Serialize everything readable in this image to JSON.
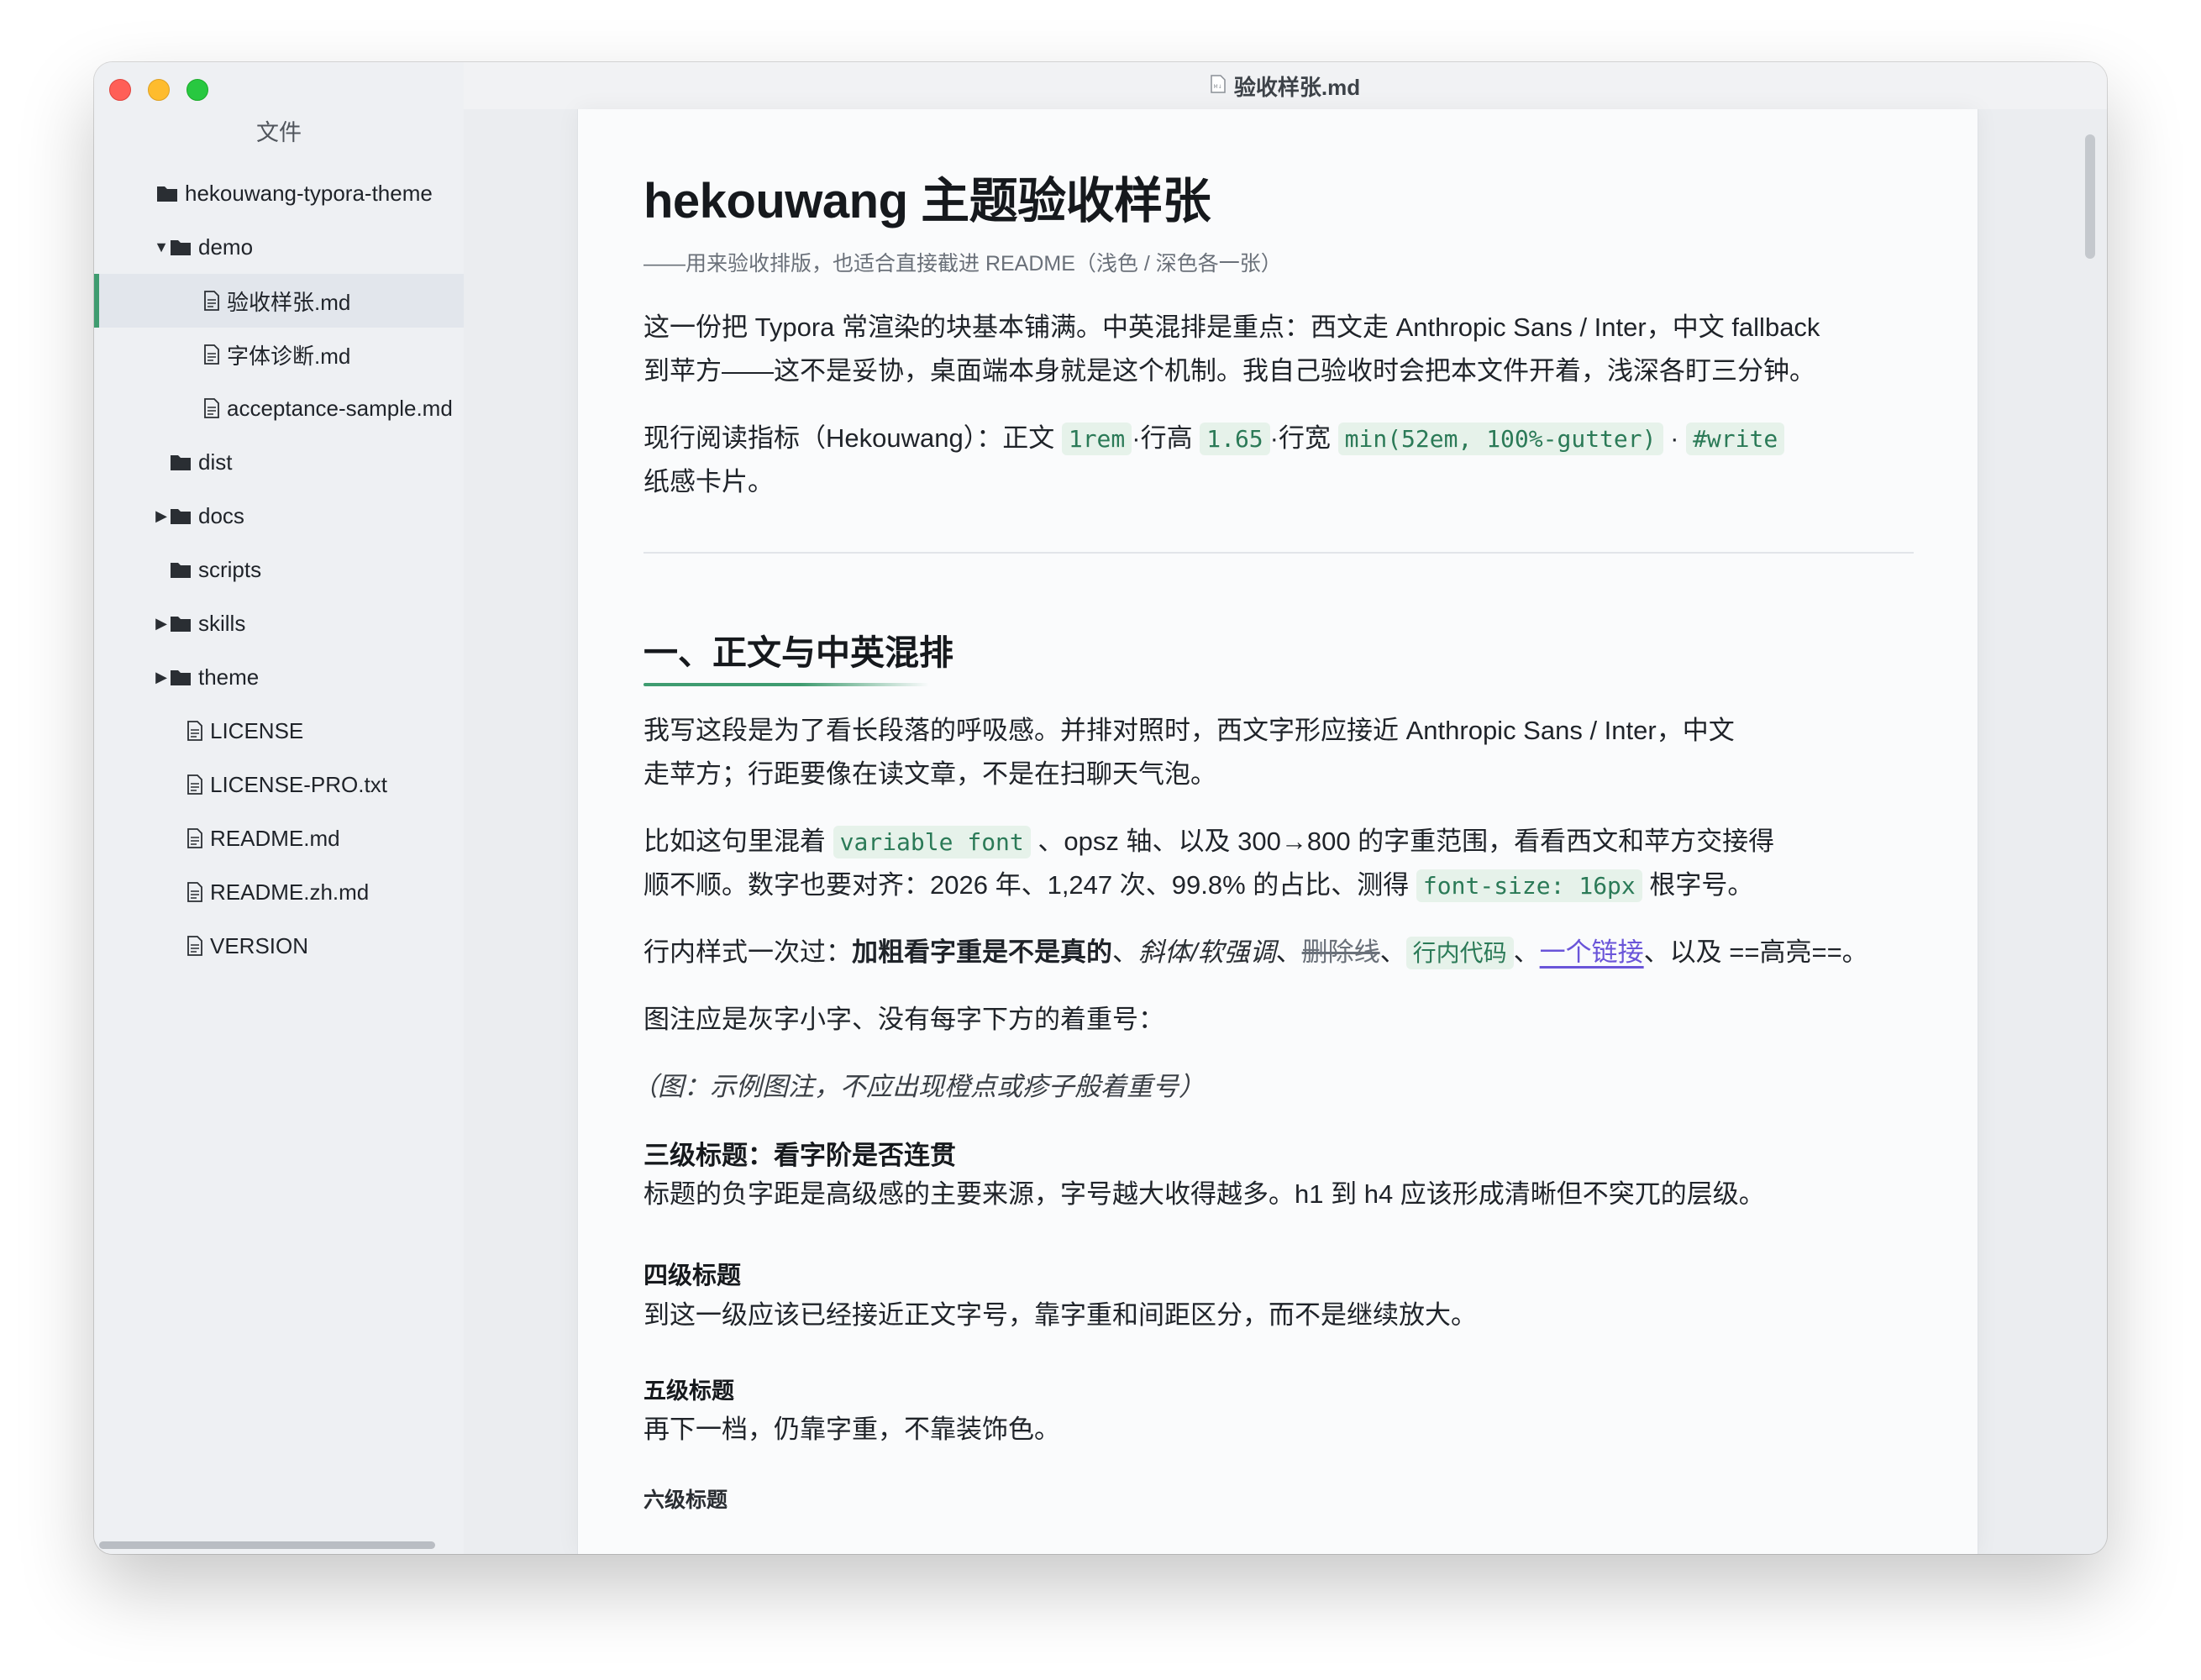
{
  "window": {
    "title": "验收样张.md"
  },
  "sidebar": {
    "title": "文件",
    "items": [
      {
        "label": "hekouwang-typora-theme",
        "kind": "folder",
        "caret": ""
      },
      {
        "label": "demo",
        "kind": "folder",
        "caret": "▼"
      },
      {
        "label": "验收样张.md",
        "kind": "file",
        "caret": ""
      },
      {
        "label": "字体诊断.md",
        "kind": "file",
        "caret": ""
      },
      {
        "label": "acceptance-sample.md",
        "kind": "file",
        "caret": ""
      },
      {
        "label": "dist",
        "kind": "folder",
        "caret": ""
      },
      {
        "label": "docs",
        "kind": "folder",
        "caret": "▶"
      },
      {
        "label": "scripts",
        "kind": "folder",
        "caret": ""
      },
      {
        "label": "skills",
        "kind": "folder",
        "caret": "▶"
      },
      {
        "label": "theme",
        "kind": "folder",
        "caret": "▶"
      },
      {
        "label": "LICENSE",
        "kind": "file",
        "caret": ""
      },
      {
        "label": "LICENSE-PRO.txt",
        "kind": "file",
        "caret": ""
      },
      {
        "label": "README.md",
        "kind": "file",
        "caret": ""
      },
      {
        "label": "README.zh.md",
        "kind": "file",
        "caret": ""
      },
      {
        "label": "VERSION",
        "kind": "file",
        "caret": ""
      }
    ],
    "active_index": 2
  },
  "doc": {
    "h1": "hekouwang 主题验收样张",
    "subtitle": "——用来验收排版，也适合直接截进 README（浅色 / 深色各一张）",
    "p1_line1": "这一份把 Typora 常渲染的块基本铺满。中英混排是重点：西文走 Anthropic Sans / Inter，中文 fallback",
    "p1_line2": "到苹方——这不是妥协，桌面端本身就是这个机制。我自己验收时会把本文件开着，浅深各盯三分钟。",
    "metric": {
      "prefix": "现行阅读指标（Hekouwang）：正文",
      "c1": "1rem",
      "t1": "·行高",
      "c2": "1.65",
      "t2": "·行宽",
      "c3": "min(52em, 100%-gutter)",
      "t3": "·",
      "c4": "#write",
      "line2": "纸感卡片。"
    },
    "h2": "一、正文与中英混排",
    "p2_line1": "我写这段是为了看长段落的呼吸感。并排对照时，西文字形应接近 Anthropic Sans / Inter，中文",
    "p2_line2": "走苹方；行距要像在读文章，不是在扫聊天气泡。",
    "p3": {
      "t1": "比如这句里混着",
      "c1": "variable font",
      "t2": "、opsz 轴、以及 300→800 的字重范围，看看西文和苹方交接得",
      "l2a": "顺不顺。数字也要对齐：2026 年、1,247 次、99.8% 的占比、测得",
      "c2": "font-size: 16px",
      "l2b": "根字号。"
    },
    "p4": {
      "t1": "行内样式一次过：",
      "bold": "加粗看字重是不是真的",
      "sep1": "、",
      "italic": "斜体/软强调",
      "sep2": "、",
      "del": "删除线",
      "sep3": "、",
      "code": "行内代码",
      "sep4": "、",
      "link": "一个链接",
      "t2": "、以及 ==高亮==。"
    },
    "p5": "图注应是灰字小字、没有每字下方的着重号：",
    "caption": "（图：示例图注，不应出现橙点或疹子般着重号）",
    "h3": "三级标题：看字阶是否连贯",
    "p6": "标题的负字距是高级感的主要来源，字号越大收得越多。h1 到 h4 应该形成清晰但不突兀的层级。",
    "h4": "四级标题",
    "p7": "到这一级应该已经接近正文字号，靠字重和间距区分，而不是继续放大。",
    "h5": "五级标题",
    "p8": "再下一档，仍靠字重，不靠装饰色。",
    "h6": "六级标题"
  },
  "colors": {
    "accent": "#3f9c70",
    "code_bg": "#e6f2ea",
    "link": "#6a55d9"
  }
}
